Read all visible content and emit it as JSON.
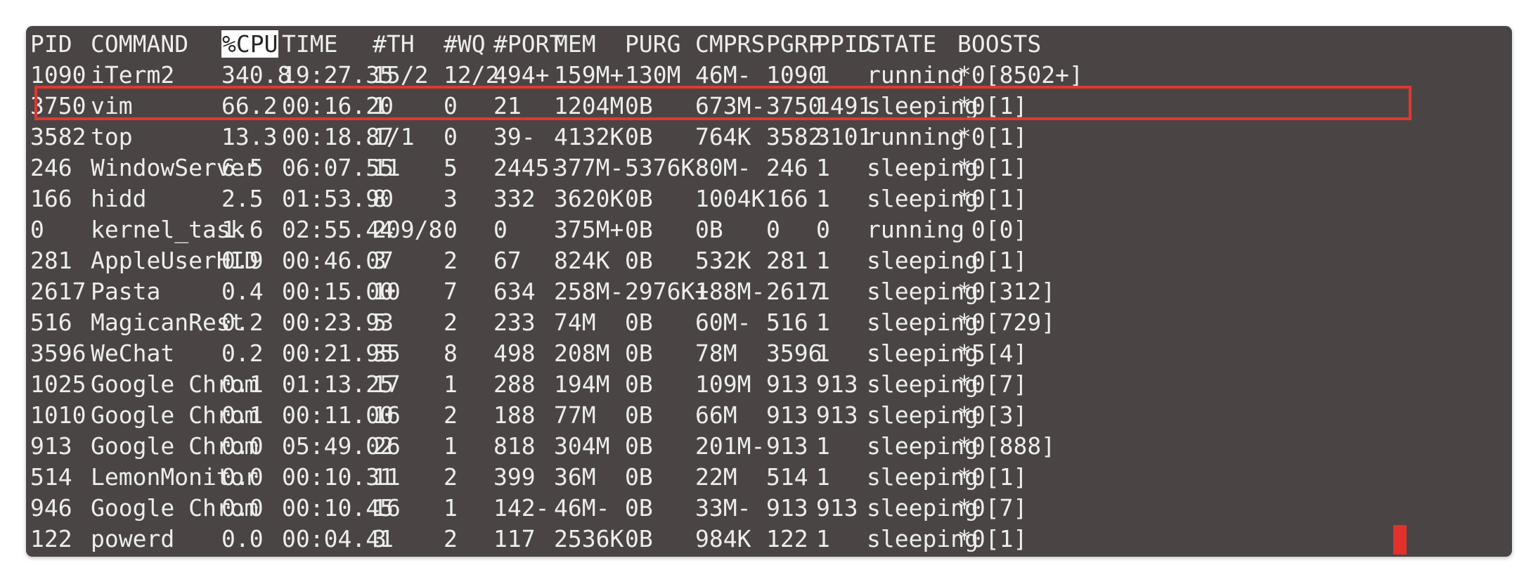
{
  "terminal": {
    "headers": [
      "PID",
      "COMMAND",
      "%CPU",
      "TIME",
      "#TH",
      "#WQ",
      "#PORT",
      "MEM",
      "PURG",
      "CMPRS",
      "PGRP",
      "PPID",
      "STATE",
      "BOOSTS"
    ],
    "sorted_column": "%CPU",
    "highlighted_row_pid": "3750",
    "rows": [
      [
        "1090",
        "iTerm2",
        "340.8",
        "19:27.35",
        "15/2",
        "12/2",
        "494+",
        "159M+",
        "130M",
        "46M-",
        "1090",
        "1",
        "running",
        "*0[8502+]"
      ],
      [
        "3750",
        "vim",
        "66.2",
        "00:16.20",
        "1",
        "0",
        "21",
        "1204M",
        "0B",
        "673M-",
        "3750",
        "1491",
        "sleeping",
        "*0[1]"
      ],
      [
        "3582",
        "top",
        "13.3",
        "00:18.87",
        "1/1",
        "0",
        "39-",
        "4132K",
        "0B",
        "764K",
        "3582",
        "3101",
        "running",
        "*0[1]"
      ],
      [
        "246",
        "WindowServer",
        "6.5",
        "06:07.55",
        "11",
        "5",
        "2445-",
        "377M-",
        "5376K",
        "80M-",
        "246",
        "1",
        "sleeping",
        "*0[1]"
      ],
      [
        "166",
        "hidd",
        "2.5",
        "01:53.90",
        "8",
        "3",
        "332",
        "3620K",
        "0B",
        "1004K",
        "166",
        "1",
        "sleeping",
        "*0[1]"
      ],
      [
        "0",
        "kernel_task",
        "1.6",
        "02:55.44",
        "209/8",
        "0",
        "0",
        "375M+",
        "0B",
        "0B",
        "0",
        "0",
        "running",
        " 0[0]"
      ],
      [
        "281",
        "AppleUserHID",
        "0.9",
        "00:46.07",
        "3",
        "2",
        "67",
        "824K",
        "0B",
        "532K",
        "281",
        "1",
        "sleeping",
        " 0[1]"
      ],
      [
        "2617",
        "Pasta",
        "0.4",
        "00:15.00",
        "10",
        "7",
        "634",
        "258M-",
        "2976K+",
        "188M-",
        "2617",
        "1",
        "sleeping",
        "*0[312]"
      ],
      [
        "516",
        "MagicanRest",
        "0.2",
        "00:23.93",
        "5",
        "2",
        "233",
        "74M",
        "0B",
        "60M-",
        "516",
        "1",
        "sleeping",
        "*0[729]"
      ],
      [
        "3596",
        "WeChat",
        "0.2",
        "00:21.95",
        "35",
        "8",
        "498",
        "208M",
        "0B",
        "78M",
        "3596",
        "1",
        "sleeping",
        "*5[4]"
      ],
      [
        "1025",
        "Google Chrom",
        "0.1",
        "01:13.25",
        "17",
        "1",
        "288",
        "194M",
        "0B",
        "109M",
        "913",
        "913",
        "sleeping",
        "*0[7]"
      ],
      [
        "1010",
        "Google Chrom",
        "0.1",
        "00:11.00",
        "16",
        "2",
        "188",
        "77M",
        "0B",
        "66M",
        "913",
        "913",
        "sleeping",
        "*0[3]"
      ],
      [
        "913",
        "Google Chrom",
        "0.0",
        "05:49.02",
        "26",
        "1",
        "818",
        "304M",
        "0B",
        "201M-",
        "913",
        "1",
        "sleeping",
        "*0[888]"
      ],
      [
        "514",
        "LemonMonitor",
        "0.0",
        "00:10.31",
        "11",
        "2",
        "399",
        "36M",
        "0B",
        "22M",
        "514",
        "1",
        "sleeping",
        "*0[1]"
      ],
      [
        "946",
        "Google Chrom",
        "0.0",
        "00:10.45",
        "16",
        "1",
        "142-",
        "46M-",
        "0B",
        "33M-",
        "913",
        "913",
        "sleeping",
        "*0[7]"
      ],
      [
        "122",
        "powerd",
        "0.0",
        "00:04.41",
        "3",
        "2",
        "117",
        "2536K",
        "0B",
        "984K",
        "122",
        "1",
        "sleeping",
        "*0[1]"
      ]
    ],
    "colors": {
      "background": "#4a4544",
      "text": "#ededed",
      "highlight_box": "#e0382f",
      "cursor": "#e2322b"
    }
  }
}
